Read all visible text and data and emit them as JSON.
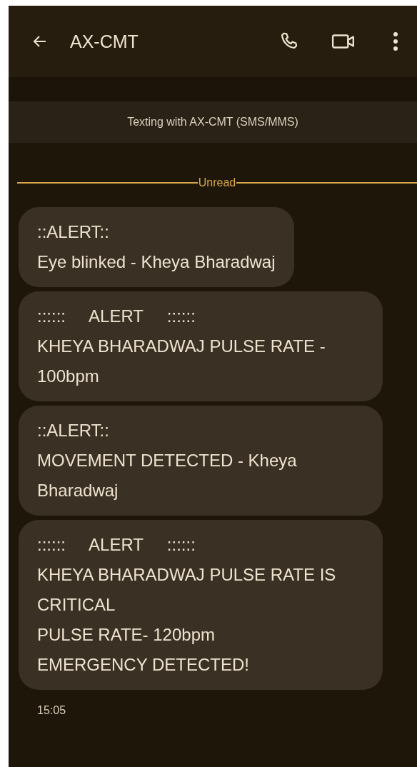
{
  "header": {
    "title": "AX-CMT"
  },
  "banner": "Texting with AX-CMT (SMS/MMS)",
  "divider": "Unread",
  "messages": [
    {
      "text": "::ALERT::\nEye blinked - Kheya Bharadwaj"
    },
    {
      "text": "::::::     ALERT     ::::::\nKHEYA BHARADWAJ PULSE RATE - 100bpm"
    },
    {
      "text": "::ALERT::\nMOVEMENT DETECTED - Kheya Bharadwaj"
    },
    {
      "text": "::::::     ALERT     ::::::\nKHEYA BHARADWAJ PULSE RATE IS CRITICAL\nPULSE RATE- 120bpm\nEMERGENCY DETECTED!"
    }
  ],
  "time": "15:05"
}
